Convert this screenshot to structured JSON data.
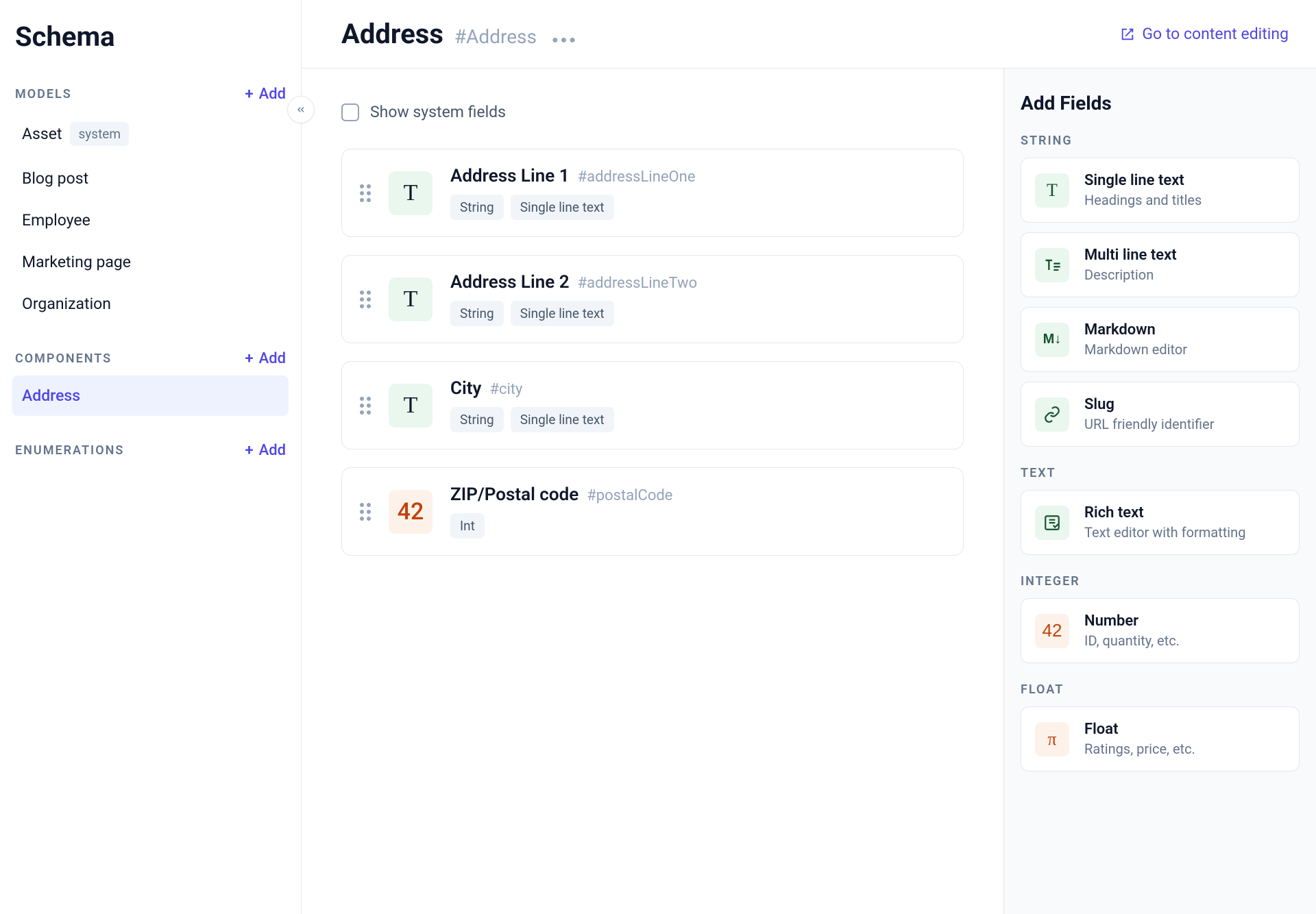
{
  "sidebar": {
    "title": "Schema",
    "add_label": "Add",
    "sections": {
      "models": {
        "title": "MODELS",
        "items": [
          {
            "label": "Asset",
            "system": true
          },
          {
            "label": "Blog post"
          },
          {
            "label": "Employee"
          },
          {
            "label": "Marketing page"
          },
          {
            "label": "Organization"
          }
        ]
      },
      "components": {
        "title": "COMPONENTS",
        "items": [
          {
            "label": "Address",
            "active": true
          }
        ]
      },
      "enumerations": {
        "title": "ENUMERATIONS",
        "items": []
      }
    },
    "system_badge": "system"
  },
  "header": {
    "model_name": "Address",
    "model_api": "#Address",
    "goto_label": "Go to content editing"
  },
  "system_fields_label": "Show system fields",
  "fields": [
    {
      "name": "Address Line 1",
      "api": "#addressLineOne",
      "type_icon": "T",
      "type_class": "string",
      "tags": [
        "String",
        "Single line text"
      ]
    },
    {
      "name": "Address Line 2",
      "api": "#addressLineTwo",
      "type_icon": "T",
      "type_class": "string",
      "tags": [
        "String",
        "Single line text"
      ]
    },
    {
      "name": "City",
      "api": "#city",
      "type_icon": "T",
      "type_class": "string",
      "tags": [
        "String",
        "Single line text"
      ]
    },
    {
      "name": "ZIP/Postal code",
      "api": "#postalCode",
      "type_icon": "42",
      "type_class": "int",
      "tags": [
        "Int"
      ]
    }
  ],
  "right": {
    "title": "Add Fields",
    "groups": [
      {
        "label": "STRING",
        "items": [
          {
            "icon": "T",
            "icon_class": "string",
            "name": "Single line text",
            "desc": "Headings and titles"
          },
          {
            "icon": "T≡",
            "icon_class": "string",
            "name": "Multi line text",
            "desc": "Description"
          },
          {
            "icon": "M↓",
            "icon_class": "string",
            "name": "Markdown",
            "desc": "Markdown editor"
          },
          {
            "icon": "🔗",
            "icon_class": "string",
            "name": "Slug",
            "desc": "URL friendly identifier"
          }
        ]
      },
      {
        "label": "TEXT",
        "items": [
          {
            "icon": "✎",
            "icon_class": "string",
            "name": "Rich text",
            "desc": "Text editor with formatting"
          }
        ]
      },
      {
        "label": "INTEGER",
        "items": [
          {
            "icon": "42",
            "icon_class": "int",
            "name": "Number",
            "desc": "ID, quantity, etc."
          }
        ]
      },
      {
        "label": "FLOAT",
        "items": [
          {
            "icon": "π",
            "icon_class": "float",
            "name": "Float",
            "desc": "Ratings, price, etc."
          }
        ]
      }
    ]
  }
}
